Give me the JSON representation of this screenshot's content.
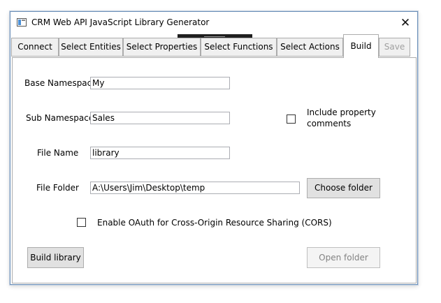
{
  "window": {
    "title": "CRM Web API JavaScript Library Generator",
    "close_glyph": "✕"
  },
  "tabs": [
    {
      "label": "Connect"
    },
    {
      "label": "Select Entities"
    },
    {
      "label": "Select Properties"
    },
    {
      "label": "Select Functions"
    },
    {
      "label": "Select Actions"
    },
    {
      "label": "Build"
    },
    {
      "label": "Save"
    }
  ],
  "active_tab": "Build",
  "form": {
    "base_namespace": {
      "label": "Base Namespace",
      "value": "My"
    },
    "sub_namespace": {
      "label": "Sub Namespace",
      "value": "Sales"
    },
    "include_property_comments": {
      "label_line1": "Include property",
      "label_line2": "comments",
      "checked": false
    },
    "file_name": {
      "label": "File Name",
      "value": "library"
    },
    "file_folder": {
      "label": "File Folder",
      "value": "A:\\Users\\Jim\\Desktop\\temp"
    },
    "choose_folder_label": "Choose folder",
    "enable_oauth": {
      "label": "Enable OAuth for Cross-Origin Resource Sharing (CORS)",
      "checked": false
    },
    "build_library_label": "Build library",
    "open_folder_label": "Open folder"
  },
  "colors": {
    "window_border": "#6b8fb8",
    "tab_bg": "#f0f0f0",
    "button_bg": "#e1e1e1",
    "disabled_text": "#838383"
  }
}
